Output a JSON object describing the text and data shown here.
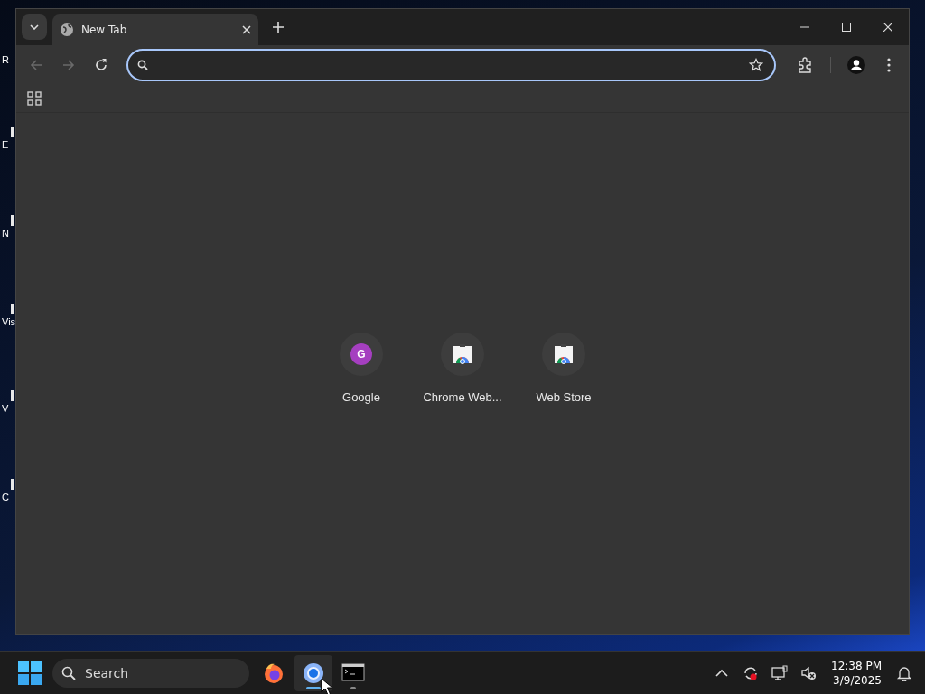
{
  "desktop_icons": [
    {
      "label": "R"
    },
    {
      "label": "E"
    },
    {
      "label": "N"
    },
    {
      "label": "Vis"
    },
    {
      "label": "V"
    },
    {
      "label": "C"
    }
  ],
  "browser": {
    "tabs": [
      {
        "title": "New Tab",
        "selected": true
      }
    ],
    "navigation": [
      {
        "kind": "back",
        "disabled": true
      },
      {
        "kind": "forward",
        "disabled": true
      },
      {
        "kind": "reload",
        "disabled": false
      }
    ],
    "shortcuts": [
      {
        "kind": "letter",
        "letter": "G",
        "label": "Google"
      },
      {
        "kind": "store",
        "label": "Chrome Web..."
      },
      {
        "kind": "store",
        "label": "Web Store"
      }
    ]
  },
  "taskbar": {
    "search": {
      "placeholder": "Search"
    },
    "apps": [
      {
        "kind": "firefox",
        "selected": false,
        "running": false
      },
      {
        "kind": "chrome",
        "selected": true,
        "running": true
      },
      {
        "kind": "terminal",
        "selected": false,
        "running": true
      }
    ],
    "clock": {
      "time": "12:38 PM",
      "date": "3/9/2025"
    }
  }
}
